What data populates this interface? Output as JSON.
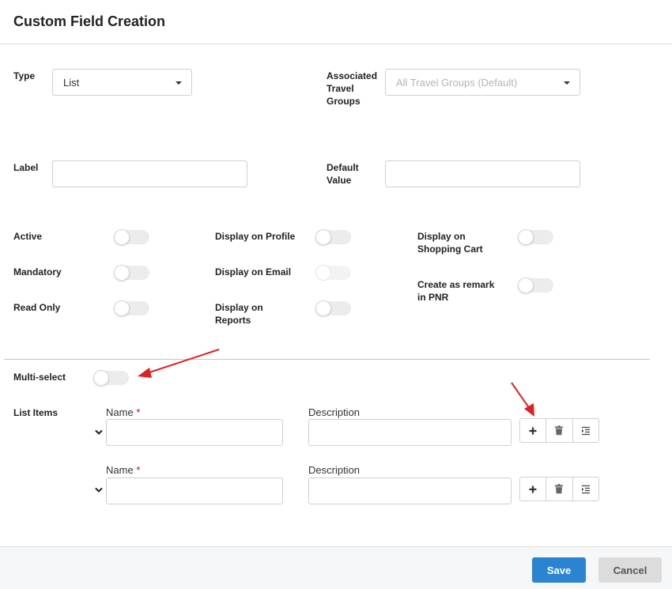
{
  "header": {
    "title": "Custom Field Creation"
  },
  "type": {
    "label": "Type",
    "value": "List"
  },
  "travel_groups": {
    "label": "Associated Travel Groups",
    "placeholder": "All Travel Groups (Default)"
  },
  "label_field": {
    "label": "Label",
    "value": ""
  },
  "default_value": {
    "label": "Default Value",
    "value": ""
  },
  "toggles": {
    "active": {
      "label": "Active",
      "on": false
    },
    "mandatory": {
      "label": "Mandatory",
      "on": false
    },
    "read_only": {
      "label": "Read Only",
      "on": false
    },
    "display_profile": {
      "label": "Display on Profile",
      "on": false
    },
    "display_email": {
      "label": "Display on Email",
      "on": false,
      "disabled": true
    },
    "display_reports": {
      "label": "Display on Reports",
      "on": false
    },
    "display_cart": {
      "label": "Display on Shopping Cart",
      "on": false
    },
    "remark_pnr": {
      "label": "Create as remark in PNR",
      "on": false
    },
    "multi_select": {
      "label": "Multi-select",
      "on": false
    }
  },
  "list_items": {
    "label": "List Items",
    "name_label": "Name",
    "required_mark": "*",
    "description_label": "Description",
    "rows": [
      {
        "name": "",
        "description": ""
      },
      {
        "name": "",
        "description": ""
      }
    ]
  },
  "icons": {
    "expand": "chevron-down-icon",
    "add": "plus-icon",
    "delete": "trash-icon",
    "indent": "indent-icon"
  },
  "footer": {
    "save_label": "Save",
    "cancel_label": "Cancel"
  },
  "colors": {
    "primary": "#2b84d2",
    "annotation_arrow": "#e02020",
    "required": "#d0021b"
  }
}
